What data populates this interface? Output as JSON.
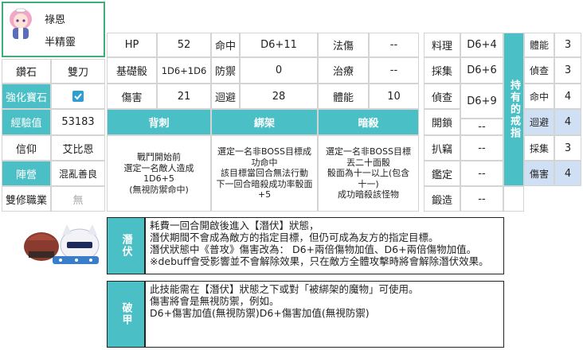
{
  "profile": {
    "name": "祿恩",
    "race": "半精靈"
  },
  "left_rows": [
    {
      "label": "鑽石",
      "value": "雙刀"
    },
    {
      "label": "強化寶石",
      "value": ""
    },
    {
      "label": "經驗值",
      "value": "53183"
    },
    {
      "label": "信仰",
      "value": "艾比恩"
    },
    {
      "label": "陣營",
      "value": "混亂善良"
    },
    {
      "label": "雙修職業",
      "value": "無"
    }
  ],
  "stats": {
    "row1": [
      "HP",
      "52",
      "命中",
      "D6+11",
      "法傷",
      "--"
    ],
    "row2": [
      "基礎骰",
      "1D6+1D6",
      "防禦",
      "0",
      "治療",
      "--"
    ],
    "row3": [
      "傷害",
      "21",
      "迴避",
      "28",
      "體能",
      "10"
    ]
  },
  "skills": [
    {
      "name": "背刺",
      "desc": [
        "戰鬥開始前",
        "選定一名敵人造成",
        "1D6+5",
        "(無視防禦命中)"
      ]
    },
    {
      "name": "綁架",
      "desc": [
        "選定一名非BOSS目標成",
        "功命中",
        "該目標當回合無法行動",
        "下一回合暗殺成功率骰面",
        "+5"
      ]
    },
    {
      "name": "暗殺",
      "desc": [
        "選定一名非BOSS目標",
        "丟二十面骰",
        "骰面為十一以上(包含",
        "十一)",
        "成功暗殺該怪物"
      ]
    }
  ],
  "life_skills": [
    {
      "label": "料理",
      "value": "D6+4"
    },
    {
      "label": "採集",
      "value": "D6+6"
    },
    {
      "label": "偵查",
      "value": "D6+9"
    },
    {
      "label": "開鎖",
      "value": "--"
    },
    {
      "label": "扒竊",
      "value": "--"
    },
    {
      "label": "鑑定",
      "value": "--"
    },
    {
      "label": "鍛造",
      "value": "--"
    }
  ],
  "ring": {
    "title": "持有的戒指",
    "rows": [
      {
        "label": "體能",
        "value": "3"
      },
      {
        "label": "偵查",
        "value": "3"
      },
      {
        "label": "命中",
        "value": "4"
      },
      {
        "label": "迴避",
        "value": "4"
      },
      {
        "label": "採集",
        "value": "3"
      },
      {
        "label": "傷害",
        "value": "4"
      }
    ]
  },
  "abilities": [
    {
      "name": "潛伏",
      "lines": [
        "耗費一回合開啟後進入【潛伏】狀態，",
        "潛伏期間不會成為敵方的指定目標，但仍可成為友方的指定目標。",
        "潛伏狀態中《普攻》傷害改為：  D6+兩倍傷物加值、D6+兩倍傷物加值。",
        "※debuff會受影響並不會解除效果，只在敵方全體攻擊時將會解除潛伏效果。"
      ]
    },
    {
      "name": "破甲",
      "lines": [
        "此技能需在【潛伏】狀態之下或對「被綁架的魔物」可使用。",
        "傷害將會是無視防禦，例如。",
        "D6+傷害加值(無視防禦)D6+傷害加值(無視防禦)"
      ]
    }
  ],
  "colors": {
    "accent": "#4bbfc6",
    "highlight": "#cfe0f5",
    "profile_border": "#3fae74"
  }
}
